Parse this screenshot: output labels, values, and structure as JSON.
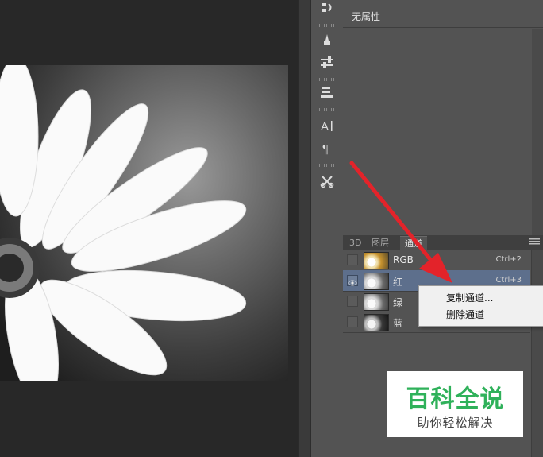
{
  "properties_panel": {
    "title": "无属性"
  },
  "tabs": [
    {
      "label": "3D",
      "active": false
    },
    {
      "label": "图层",
      "active": false
    },
    {
      "label": "通道",
      "active": true
    }
  ],
  "channels": [
    {
      "name": "RGB",
      "shortcut": "Ctrl+2",
      "visible": false,
      "selected": false
    },
    {
      "name": "红",
      "shortcut": "Ctrl+3",
      "visible": true,
      "selected": true
    },
    {
      "name": "绿",
      "shortcut": "",
      "visible": false,
      "selected": false
    },
    {
      "name": "蓝",
      "shortcut": "",
      "visible": false,
      "selected": false
    }
  ],
  "context_menu": {
    "items": [
      "复制通道...",
      "删除通道"
    ]
  },
  "watermark": {
    "title": "百科全说",
    "subtitle": "助你轻松解决"
  },
  "tools": [
    "tool-preset-icon",
    "brush-icon",
    "adjust-sliders-icon",
    "stamp-icon",
    "character-icon",
    "paragraph-icon",
    "scissors-icon"
  ],
  "colors": {
    "selection": "#5d6f8c",
    "arrow": "#e3232a",
    "brand_green": "#2fb15a"
  }
}
